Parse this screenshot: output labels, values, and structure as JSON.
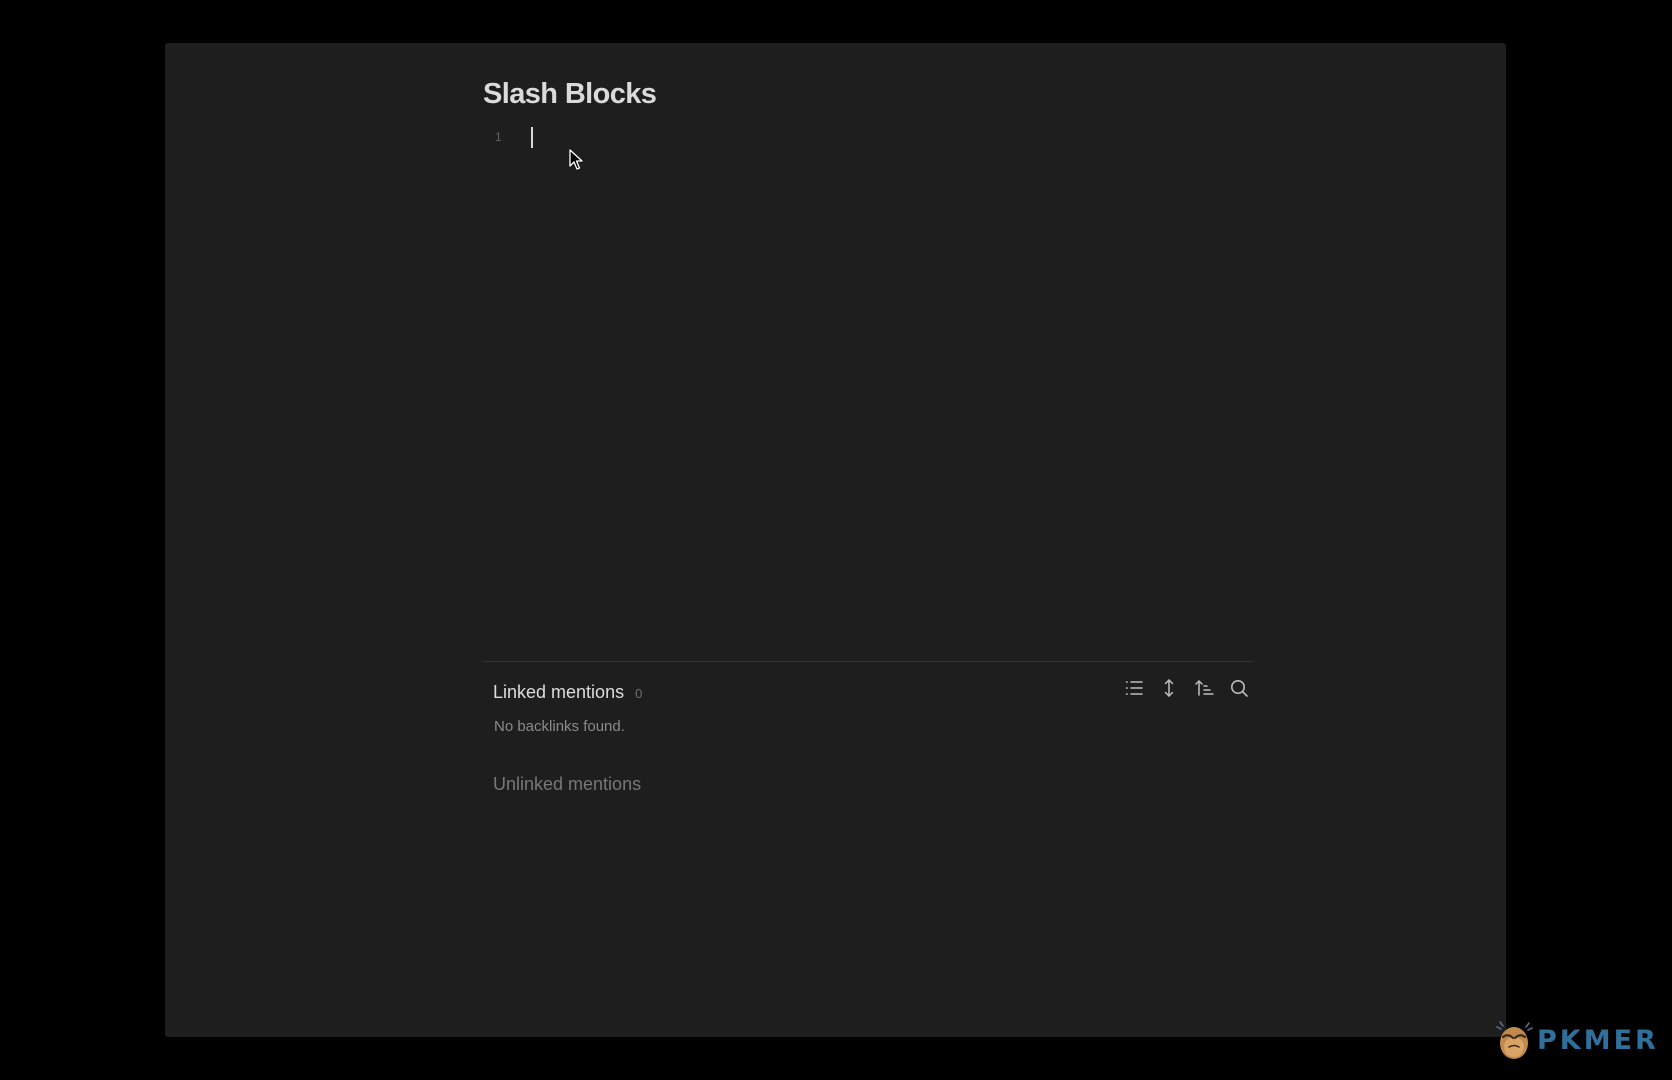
{
  "note": {
    "title": "Slash Blocks",
    "lines": [
      {
        "number": "1",
        "text": ""
      }
    ]
  },
  "backlinks": {
    "linked_title": "Linked mentions",
    "linked_count": "0",
    "empty_message": "No backlinks found.",
    "unlinked_title": "Unlinked mentions",
    "toolbar": [
      {
        "name": "collapse-results-button",
        "icon": "list-icon"
      },
      {
        "name": "show-more-context-button",
        "icon": "vertical-arrows-icon"
      },
      {
        "name": "change-sort-order-button",
        "icon": "sort-icon"
      },
      {
        "name": "show-search-filter-button",
        "icon": "search-icon"
      }
    ]
  },
  "watermark": {
    "text": "PKMER",
    "colors": [
      "#2f6f9a",
      "#5b5fa6"
    ]
  },
  "colors": {
    "background": "#000000",
    "pane": "#1e1e1e",
    "title": "#dadada",
    "muted": "#6e6e6e",
    "icon": "#bdbdbd"
  }
}
